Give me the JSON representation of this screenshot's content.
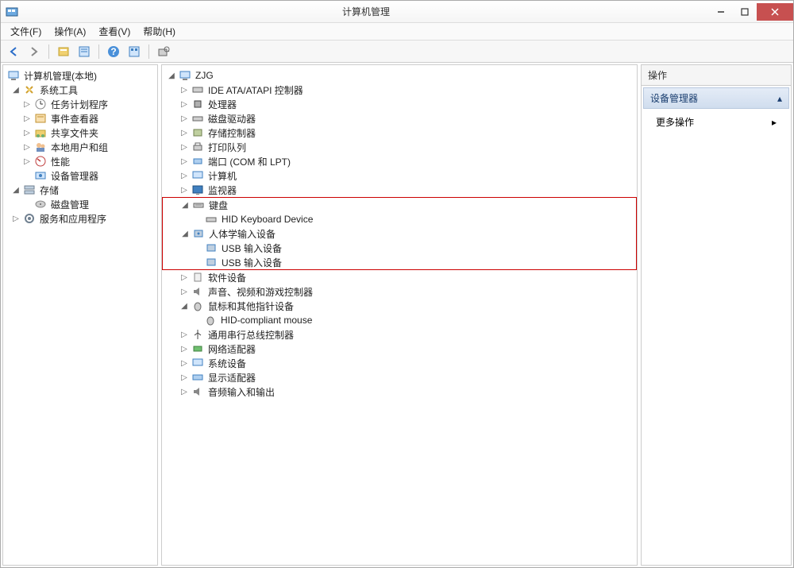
{
  "window": {
    "title": "计算机管理"
  },
  "menu": {
    "file": "文件(F)",
    "action": "操作(A)",
    "view": "查看(V)",
    "help": "帮助(H)"
  },
  "left_tree": {
    "root": "计算机管理(本地)",
    "tools": "系统工具",
    "task_scheduler": "任务计划程序",
    "event_viewer": "事件查看器",
    "shared_folders": "共享文件夹",
    "local_users": "本地用户和组",
    "performance": "性能",
    "device_manager": "设备管理器",
    "storage": "存储",
    "disk_management": "磁盘管理",
    "services": "服务和应用程序"
  },
  "device_tree": {
    "root": "ZJG",
    "ide": "IDE ATA/ATAPI 控制器",
    "cpu": "处理器",
    "disk_drives": "磁盘驱动器",
    "storage_ctrl": "存储控制器",
    "print_queue": "打印队列",
    "ports": "端口 (COM 和 LPT)",
    "computer": "计算机",
    "monitor": "监视器",
    "keyboard": "键盘",
    "hid_keyboard": "HID Keyboard Device",
    "hid_devices": "人体学输入设备",
    "usb_input1": "USB 输入设备",
    "usb_input2": "USB 输入设备",
    "software": "软件设备",
    "sound": "声音、视频和游戏控制器",
    "mouse": "鼠标和其他指针设备",
    "hid_mouse": "HID-compliant mouse",
    "usb_ctrl": "通用串行总线控制器",
    "network": "网络适配器",
    "system": "系统设备",
    "display": "显示适配器",
    "audio": "音频输入和输出"
  },
  "actions": {
    "header": "操作",
    "device_manager": "设备管理器",
    "more": "更多操作"
  }
}
